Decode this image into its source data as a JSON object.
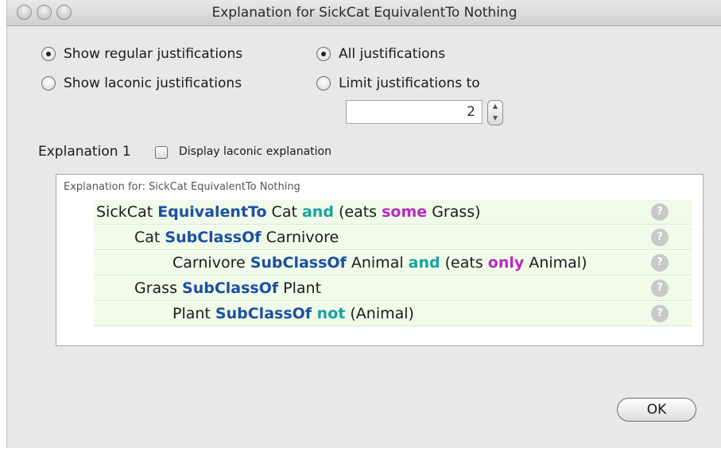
{
  "window": {
    "title": "Explanation for SickCat EquivalentTo Nothing"
  },
  "options": {
    "show_regular": "Show regular justifications",
    "show_laconic": "Show laconic justifications",
    "all_justifications": "All justifications",
    "limit_justifications": "Limit justifications to",
    "limit_value": "2",
    "selected_justification_type": "regular",
    "selected_count_mode": "all"
  },
  "explanation": {
    "label": "Explanation 1",
    "laconic_checkbox_label": "Display laconic explanation",
    "laconic_checked": false,
    "header": "Explanation for: SickCat EquivalentTo Nothing",
    "help_glyph": "?",
    "axioms": [
      {
        "indent": 0,
        "parts": [
          {
            "text": "SickCat ",
            "style": "plain"
          },
          {
            "text": "EquivalentTo",
            "style": "blue"
          },
          {
            "text": " Cat ",
            "style": "plain"
          },
          {
            "text": "and",
            "style": "teal"
          },
          {
            "text": " (eats ",
            "style": "plain"
          },
          {
            "text": "some",
            "style": "purple"
          },
          {
            "text": " Grass)",
            "style": "plain"
          }
        ]
      },
      {
        "indent": 1,
        "parts": [
          {
            "text": "Cat ",
            "style": "plain"
          },
          {
            "text": "SubClassOf",
            "style": "blue"
          },
          {
            "text": " Carnivore",
            "style": "plain"
          }
        ]
      },
      {
        "indent": 2,
        "parts": [
          {
            "text": "Carnivore ",
            "style": "plain"
          },
          {
            "text": "SubClassOf",
            "style": "blue"
          },
          {
            "text": " Animal ",
            "style": "plain"
          },
          {
            "text": "and",
            "style": "teal"
          },
          {
            "text": " (eats ",
            "style": "plain"
          },
          {
            "text": "only",
            "style": "purple"
          },
          {
            "text": " Animal)",
            "style": "plain"
          }
        ]
      },
      {
        "indent": 1,
        "parts": [
          {
            "text": "Grass ",
            "style": "plain"
          },
          {
            "text": "SubClassOf",
            "style": "blue"
          },
          {
            "text": " Plant",
            "style": "plain"
          }
        ]
      },
      {
        "indent": 2,
        "parts": [
          {
            "text": "Plant ",
            "style": "plain"
          },
          {
            "text": "SubClassOf",
            "style": "blue"
          },
          {
            "text": " not",
            "style": "teal"
          },
          {
            "text": " (Animal)",
            "style": "plain"
          }
        ]
      }
    ]
  },
  "buttons": {
    "ok": "OK"
  },
  "colors": {
    "keyword_blue": "#1c4fa3",
    "keyword_teal": "#17a3a3",
    "keyword_purple": "#b52cc2",
    "row_background": "#f0fbe9"
  }
}
